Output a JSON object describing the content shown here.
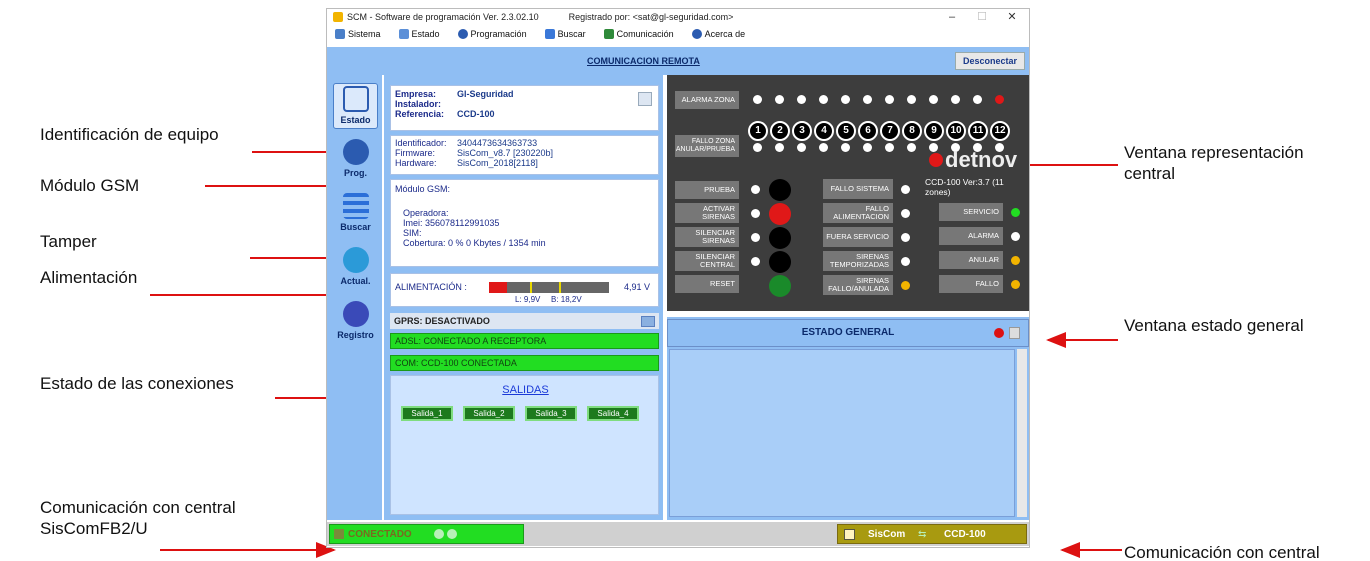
{
  "annotations": {
    "identificacion": "Identificación de equipo",
    "modulo_gsm": "Módulo GSM",
    "tamper": "Tamper",
    "alimentacion": "Alimentación",
    "estado_conexiones": "Estado de las conexiones",
    "comunicacion_1": "Comunicación con central",
    "comunicacion_2": "SisComFB2/U",
    "ventana_central_1": "Ventana representación",
    "ventana_central_2": "central",
    "ventana_estado": "Ventana estado general",
    "comunicacion_central": "Comunicación con central"
  },
  "window": {
    "title": "SCM - Software de programación Ver. 2.3.02.10",
    "registered": "Registrado por:   <sat@gl-seguridad.com>",
    "minimize": "–",
    "maximize": "☐",
    "close": "✕"
  },
  "menu": [
    "Sistema",
    "Estado",
    "Programación",
    "Buscar",
    "Comunicación",
    "Acerca de"
  ],
  "header": {
    "title": "COMUNICACION REMOTA",
    "disconnect": "Desconectar"
  },
  "sidebar": [
    "Estado",
    "Prog.",
    "Buscar",
    "Actual.",
    "Registro"
  ],
  "company": {
    "empresa_k": "Empresa:",
    "empresa_v": "Gl-Seguridad",
    "instalador_k": "Instalador:",
    "instalador_v": "",
    "referencia_k": "Referencia:",
    "referencia_v": "CCD-100"
  },
  "device": {
    "identificador_k": "Identificador:",
    "identificador_v": "3404473634363733",
    "firmware_k": "Firmware:",
    "firmware_v": "SisCom_v8.7 [230220b]",
    "hardware_k": "Hardware:",
    "hardware_v": "SisCom_2018[2118]"
  },
  "gsm": {
    "title": "Módulo GSM:",
    "operadora": "Operadora:",
    "imei": "Imei:  356078112991035",
    "sim": "SIM:",
    "cobertura": "Cobertura:   0 %       0 Kbytes / 1354 min"
  },
  "power": {
    "label": "ALIMENTACIÓN :",
    "value": "4,91 V",
    "low": "L: 9,9V",
    "high": "B: 18,2V",
    "level": 0.15
  },
  "gprs": "GPRS: DESACTIVADO",
  "adsl": "ADSL: CONECTADO A RECEPTORA",
  "com": "COM: CCD-100 CONECTADA",
  "salidas_title": "SALIDAS",
  "salidas": [
    "Salida_1",
    "Salida_2",
    "Salida_3",
    "Salida_4"
  ],
  "central": {
    "alarma_zona": "ALARMA ZONA",
    "fallo_zona": "FALLO ZONA ANULAR/PRUEBA",
    "zones": [
      "1",
      "2",
      "3",
      "4",
      "5",
      "6",
      "7",
      "8",
      "9",
      "10",
      "11",
      "12"
    ],
    "brand": "detnov",
    "model": "CCD-100 Ver:3.7 (11 zones)",
    "left_buttons": [
      "PRUEBA",
      "ACTIVAR SIRENAS",
      "SILENCIAR SIRENAS",
      "SILENCIAR CENTRAL",
      "RESET"
    ],
    "mid_buttons": [
      "FALLO SISTEMA",
      "FALLO ALIMENTACION",
      "FUERA SERVICIO",
      "SIRENAS TEMPORIZADAS",
      "SIRENAS FALLO/ANULADA"
    ],
    "right_buttons": [
      "SERVICIO",
      "ALARMA",
      "ANULAR",
      "FALLO"
    ]
  },
  "estado_general": "ESTADO GENERAL",
  "statusbar": {
    "connected": "CONECTADO",
    "siscom": "SisCom",
    "target": "CCD-100"
  }
}
